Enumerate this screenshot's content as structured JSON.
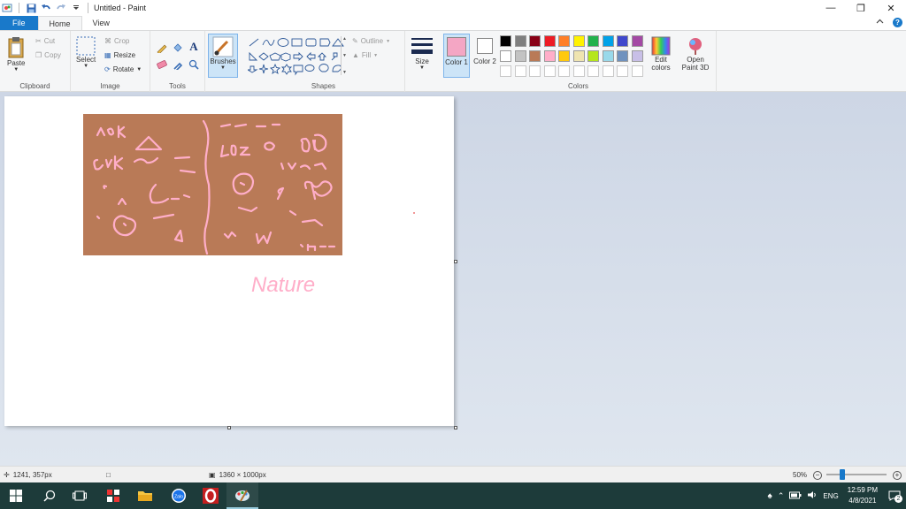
{
  "window": {
    "title": "Untitled - Paint"
  },
  "tabs": [
    "File",
    "Home",
    "View"
  ],
  "ribbon": {
    "clipboard": {
      "label": "Clipboard",
      "paste": "Paste",
      "cut": "Cut",
      "copy": "Copy"
    },
    "image": {
      "label": "Image",
      "select": "Select",
      "crop": "Crop",
      "resize": "Resize",
      "rotate": "Rotate"
    },
    "tools": {
      "label": "Tools"
    },
    "brushes": {
      "label": "Brushes"
    },
    "shapes": {
      "label": "Shapes",
      "outline": "Outline",
      "fill": "Fill"
    },
    "size": {
      "label": "Size"
    },
    "colors": {
      "label": "Colors",
      "color1": "Color 1",
      "color2": "Color 2",
      "edit_colors": "Edit colors",
      "open_paint3d": "Open Paint 3D",
      "color1_value": "#f4a6c4",
      "color2_value": "#ffffff",
      "row1": [
        "#000000",
        "#7f7f7f",
        "#880015",
        "#ed1c24",
        "#ff7f27",
        "#fff200",
        "#22b14c",
        "#00a2e8",
        "#3f48cc",
        "#a349a4"
      ],
      "row2": [
        "#ffffff",
        "#c3c3c3",
        "#b97a57",
        "#ffaec9",
        "#ffc90e",
        "#efe4b0",
        "#b5e61d",
        "#99d9ea",
        "#7092be",
        "#c8bfe7"
      ]
    }
  },
  "canvas": {
    "background": "#b97a57",
    "stroke": "#ffaec9",
    "caption": "Nature"
  },
  "statusbar": {
    "cursor_pos": "1241, 357px",
    "image_size": "1360 × 1000px",
    "zoom": "50%"
  },
  "taskbar": {
    "language": "ENG",
    "time": "12:59 PM",
    "date": "4/8/2021",
    "notifications": "2"
  }
}
